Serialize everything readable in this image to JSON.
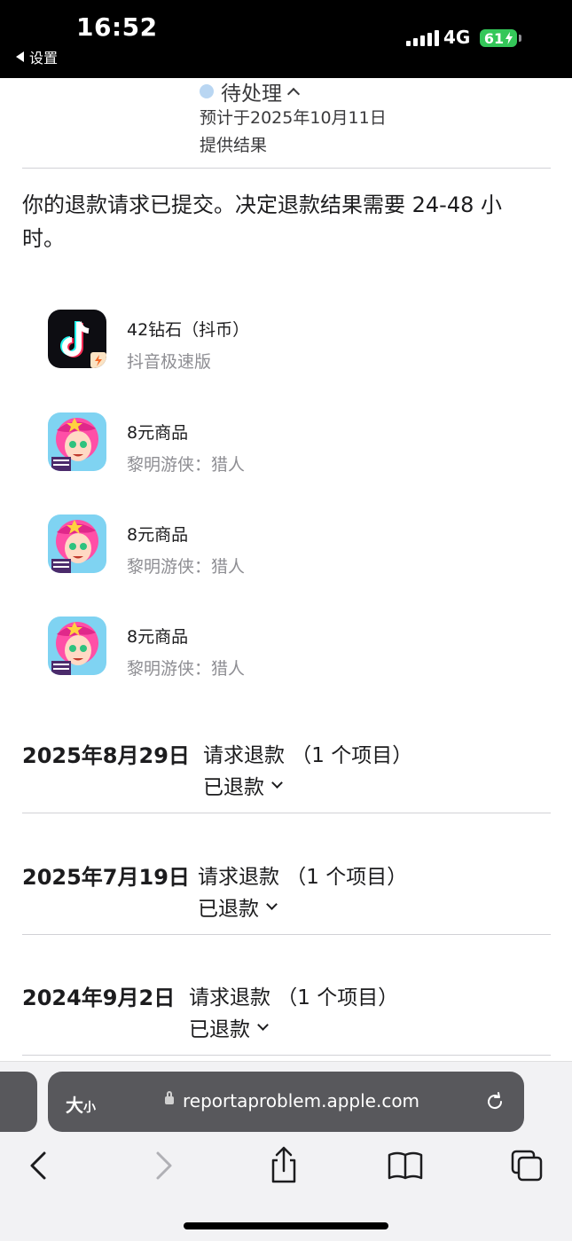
{
  "status_bar": {
    "time": "16:52",
    "back_label": "设置",
    "network": "4G",
    "battery": "61"
  },
  "pending": {
    "label": "待处理",
    "estimate_line1": "预计于2025年10月11日",
    "estimate_line2": "提供结果"
  },
  "notice": "你的退款请求已提交。决定退款结果需要 24-48 小时。",
  "items": [
    {
      "name": "42钻石（抖币）",
      "app": "抖音极速版",
      "icon": "douyin-lite-icon"
    },
    {
      "name": "8元商品",
      "app": "黎明游侠：猎人",
      "icon": "game-character-icon"
    },
    {
      "name": "8元商品",
      "app": "黎明游侠：猎人",
      "icon": "game-character-icon"
    },
    {
      "name": "8元商品",
      "app": "黎明游侠：猎人",
      "icon": "game-character-icon"
    }
  ],
  "requests": [
    {
      "date": "2025年8月29日",
      "title": "请求退款 （1 个项目）",
      "status": "已退款"
    },
    {
      "date": "2025年7月19日",
      "title": "请求退款 （1 个项目）",
      "status": "已退款"
    },
    {
      "date": "2024年9月2日",
      "title": "请求退款 （1 个项目）",
      "status": "已退款"
    }
  ],
  "browser": {
    "text_size_big": "大",
    "text_size_small": "小",
    "url": "reportaproblem.apple.com"
  },
  "colors": {
    "pending_dot": "#b9d6f2",
    "battery": "#34c759",
    "urlbar": "#58585c"
  }
}
